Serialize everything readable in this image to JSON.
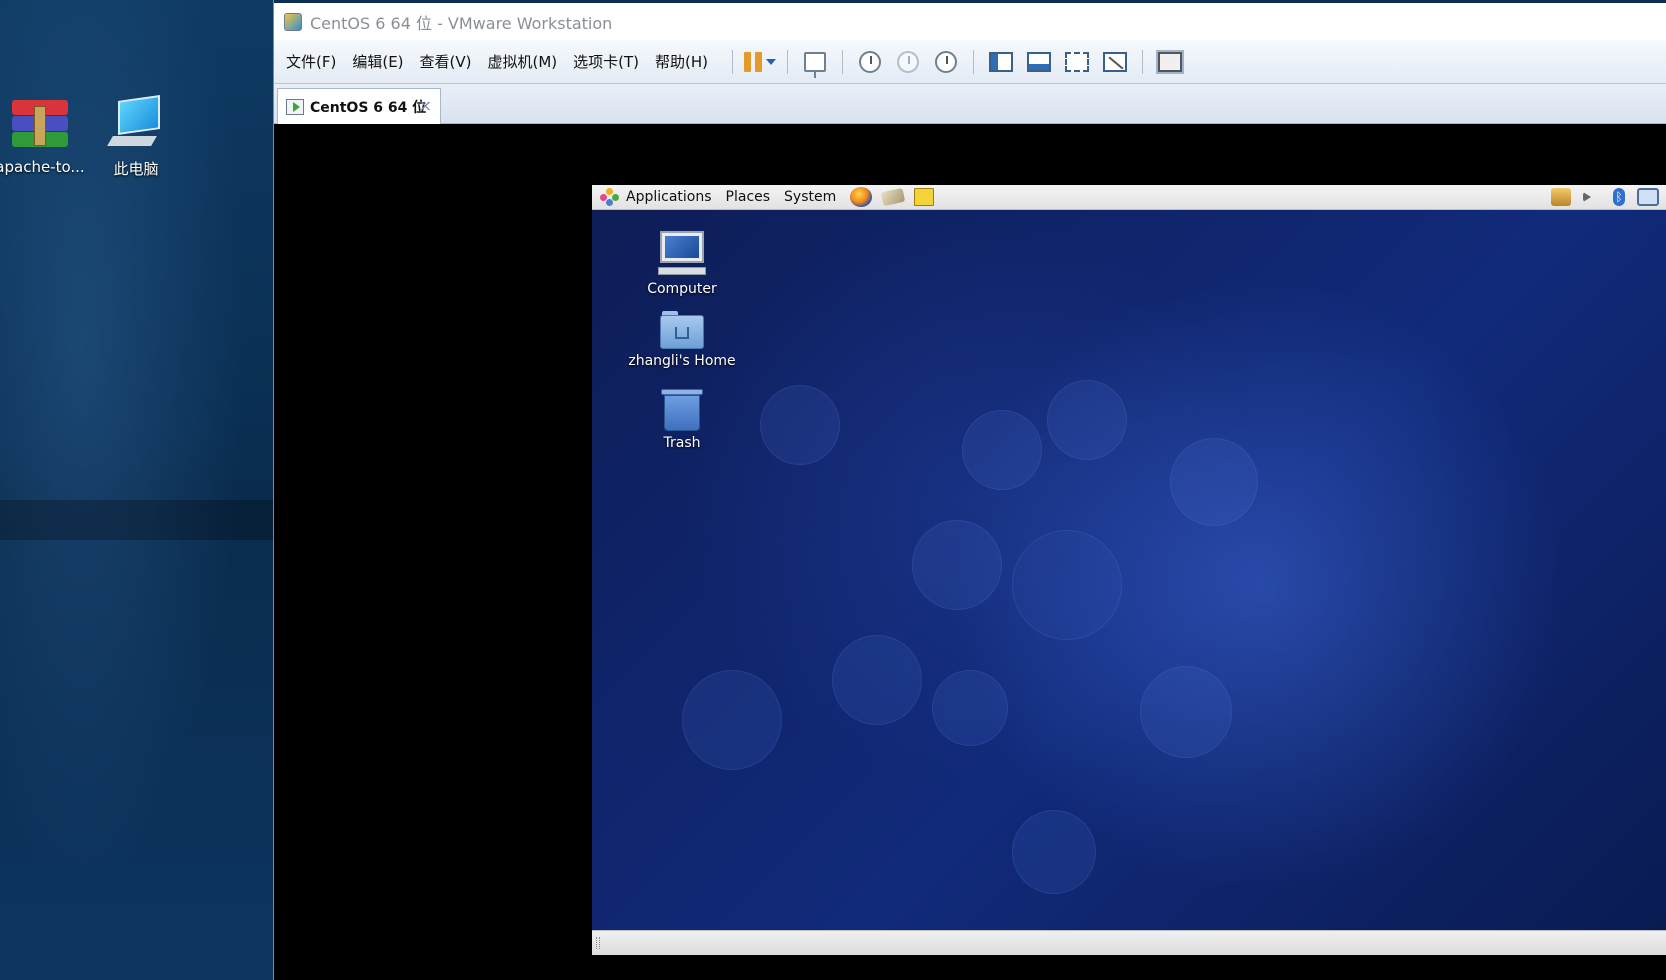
{
  "host": {
    "desktop_icons": [
      {
        "label": "apache-to...",
        "icon": "winrar-archive-icon"
      },
      {
        "label": "此电脑",
        "icon": "this-pc-icon"
      }
    ]
  },
  "window": {
    "title": "CentOS 6 64 位 - VMware Workstation",
    "menu": [
      "文件(F)",
      "编辑(E)",
      "查看(V)",
      "虚拟机(M)",
      "选项卡(T)",
      "帮助(H)"
    ],
    "toolbar_icons": [
      "pause-icon",
      "dropdown-arrow-icon",
      "send-ctrl-alt-del-icon",
      "snapshot-take-icon",
      "snapshot-revert-icon",
      "snapshot-manager-icon",
      "show-library-icon",
      "show-thumbnail-bar-icon",
      "full-screen-icon",
      "unity-icon",
      "console-view-icon"
    ],
    "tab": {
      "label": "CentOS 6 64 位",
      "close": "×"
    }
  },
  "guest": {
    "panel_menus": [
      "Applications",
      "Places",
      "System"
    ],
    "launchers": [
      "firefox-icon",
      "mail-client-icon",
      "notes-editor-icon"
    ],
    "tray": [
      "software-update-icon",
      "volume-icon",
      "bluetooth-icon",
      "network-icon"
    ],
    "desktop_icons": [
      {
        "label": "Computer",
        "icon": "computer-icon"
      },
      {
        "label": "zhangli's Home",
        "icon": "home-folder-icon"
      },
      {
        "label": "Trash",
        "icon": "trash-icon"
      }
    ]
  },
  "colors": {
    "host_desktop": "#0e3a62",
    "guest_wallpaper": "#112a7a",
    "pause_accent": "#e39a2a"
  }
}
